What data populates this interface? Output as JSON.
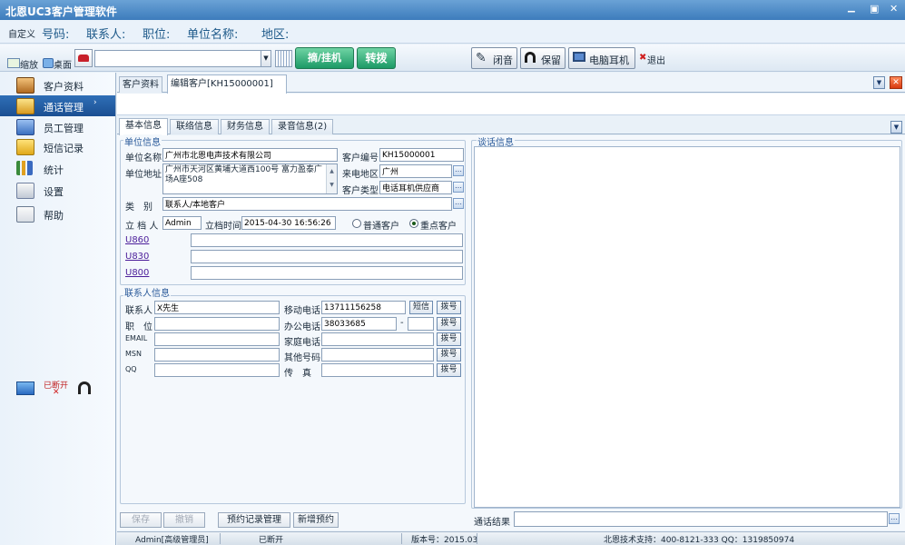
{
  "window": {
    "title": "北恩UC3客户管理软件",
    "controls": [
      "▁",
      "▣",
      "✕"
    ]
  },
  "infobar": {
    "custom": "自定义",
    "fields": [
      "号码:",
      "联系人:",
      "职位:",
      "单位名称:",
      "地区:"
    ]
  },
  "toolbar": {
    "shrink": "缩放",
    "desktop": "桌面",
    "dial_value": "",
    "hangup": "摘/挂机",
    "transfer": "转拨",
    "mute": "闭音",
    "hold": "保留",
    "headset": "电脑耳机",
    "exit": "退出"
  },
  "sidebar": {
    "items": [
      {
        "label": "客户资料",
        "icon": "customer-card-icon"
      },
      {
        "label": "通话管理",
        "icon": "call-management-icon"
      },
      {
        "label": "员工管理",
        "icon": "staff-icon"
      },
      {
        "label": "短信记录",
        "icon": "envelope-icon"
      },
      {
        "label": "统计",
        "icon": "bar-chart-icon"
      },
      {
        "label": "设置",
        "icon": "settings-icon"
      },
      {
        "label": "帮助",
        "icon": "help-icon"
      }
    ],
    "status": "已断开"
  },
  "tabs": [
    "客户资料",
    "编辑客户[KH15000001]"
  ],
  "subtabs": [
    "基本信息",
    "联络信息",
    "财务信息",
    "录音信息(2)"
  ],
  "unit": {
    "section": "单位信息",
    "name_label": "单位名称",
    "name": "广州市北恩电声技术有限公司",
    "code_label": "客户编号",
    "code": "KH15000001",
    "address_label": "单位地址",
    "address": "广州市天河区黄埔大道西100号 富力盈泰广场A座508",
    "region_label": "来电地区",
    "region": "广州",
    "type_label": "客户类型",
    "type": "电话耳机供应商",
    "category_label": "类　别",
    "category": "联系人/本地客户",
    "creator_label": "立 档 人",
    "creator": "Admin",
    "time_label": "立档时间",
    "time": "2015-04-30 16:56:26",
    "radio_normal": "普通客户",
    "radio_key": "重点客户",
    "links": [
      "U860",
      "U830",
      "U800"
    ]
  },
  "contact": {
    "section": "联系人信息",
    "person_label": "联系人",
    "person": "X先生",
    "position_label": "职　位",
    "email_label": "EMAIL",
    "msn_label": "MSN",
    "qq_label": "QQ",
    "mobile_label": "移动电话",
    "mobile": "13711156258",
    "sms": "短信",
    "office_label": "办公电话",
    "office": "38033685",
    "dash": "-",
    "home_label": "家庭电话",
    "other_label": "其他号码",
    "fax_label": "传　真",
    "dial": "拨号"
  },
  "talk": {
    "section": "谈话信息",
    "result_label": "通话结果"
  },
  "actions": [
    "保存",
    "撤销",
    "预约记录管理",
    "新增预约"
  ],
  "statusbar": {
    "user": "Admin[高级管理员]",
    "conn": "已断开",
    "version": "版本号：2015.03",
    "support": "北恩技术支持：400-8121-333 QQ：1319850974"
  }
}
